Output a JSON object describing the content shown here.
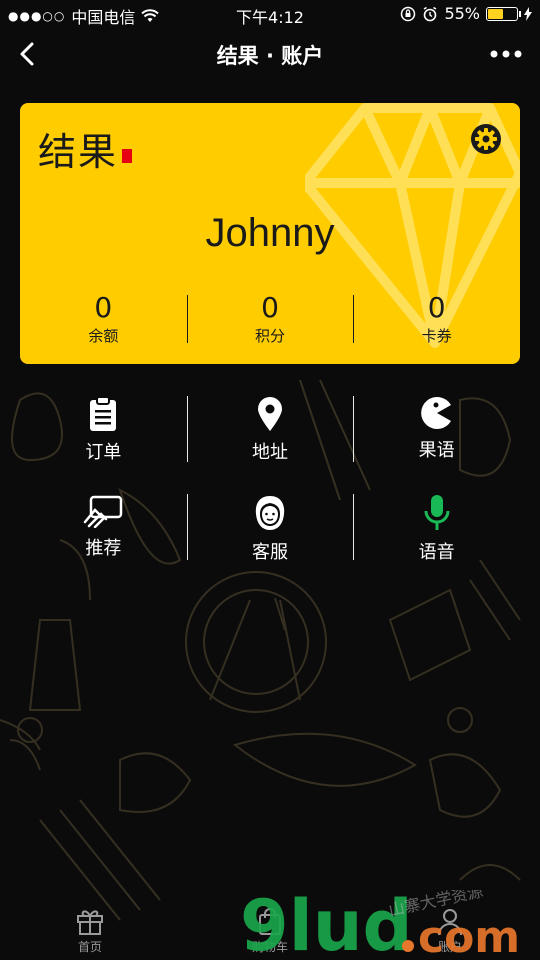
{
  "status_bar": {
    "signal": "●●●○○",
    "carrier": "中国电信",
    "time": "下午4:12",
    "battery_percent": "55%",
    "battery_level": 0.55
  },
  "nav": {
    "title": "结果 · 账户"
  },
  "card": {
    "logo": "结果",
    "name": "Johnny",
    "stats": [
      {
        "value": "0",
        "label": "余额"
      },
      {
        "value": "0",
        "label": "积分"
      },
      {
        "value": "0",
        "label": "卡券"
      }
    ]
  },
  "grid": [
    {
      "label": "订单",
      "icon": "clipboard-icon"
    },
    {
      "label": "地址",
      "icon": "location-pin-icon"
    },
    {
      "label": "果语",
      "icon": "pacman-icon"
    },
    {
      "label": "推荐",
      "icon": "share-card-icon"
    },
    {
      "label": "客服",
      "icon": "customer-service-icon"
    },
    {
      "label": "语音",
      "icon": "microphone-icon"
    }
  ],
  "tabs": [
    {
      "label": "首页",
      "icon": "gift-icon"
    },
    {
      "label": "购物车",
      "icon": "bag-icon"
    },
    {
      "label": "账户",
      "icon": "person-icon"
    }
  ],
  "colors": {
    "accent": "#ffcc00",
    "background": "#0b0b0b",
    "mic_green": "#19b955",
    "watermark_green": "#1aa64a",
    "watermark_orange": "#e8762b"
  },
  "watermark": {
    "text": "9lud.com",
    "subtext": "山寨大学资源"
  }
}
